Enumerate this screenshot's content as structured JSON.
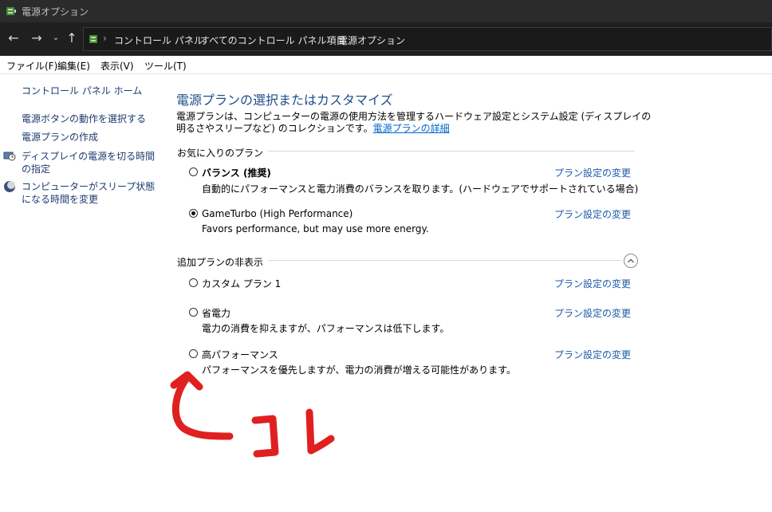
{
  "window": {
    "title": "電源オプション"
  },
  "address": {
    "crumbs": [
      "コントロール パネル",
      "すべてのコントロール パネル項目",
      "電源オプション"
    ]
  },
  "menu": [
    "ファイル(F)",
    "編集(E)",
    "表示(V)",
    "ツール(T)"
  ],
  "sidebar": {
    "home": "コントロール パネル ホーム",
    "links": [
      "電源ボタンの動作を選択する",
      "電源プランの作成",
      "ディスプレイの電源を切る時間の指定",
      "コンピューターがスリープ状態になる時間を変更"
    ]
  },
  "main": {
    "heading": "電源プランの選択またはカスタマイズ",
    "description": "電源プランは、コンピューターの電源の使用方法を管理するハードウェア設定とシステム設定 (ディスプレイの明るさやスリープなど) のコレクションです。",
    "details_link": "電源プランの詳細",
    "favorites_label": "お気に入りのプラン",
    "extra_label": "追加プランの非表示",
    "change_link": "プラン設定の変更",
    "favorite_plans": [
      {
        "name": "バランス (推奨)",
        "desc": "自動的にパフォーマンスと電力消費のバランスを取ります。(ハードウェアでサポートされている場合)",
        "selected": false
      },
      {
        "name": "GameTurbo (High Performance)",
        "desc": "Favors performance, but may use more energy.",
        "selected": true
      }
    ],
    "extra_plans": [
      {
        "name": "カスタム プラン 1",
        "desc": "",
        "selected": false
      },
      {
        "name": "省電力",
        "desc": "電力の消費を抑えますが、パフォーマンスは低下します。",
        "selected": false
      },
      {
        "name": "高パフォーマンス",
        "desc": "パフォーマンスを優先しますが、電力の消費が増える可能性があります。",
        "selected": false
      }
    ]
  },
  "annotation": {
    "text": "コレ",
    "color": "#e02020"
  }
}
